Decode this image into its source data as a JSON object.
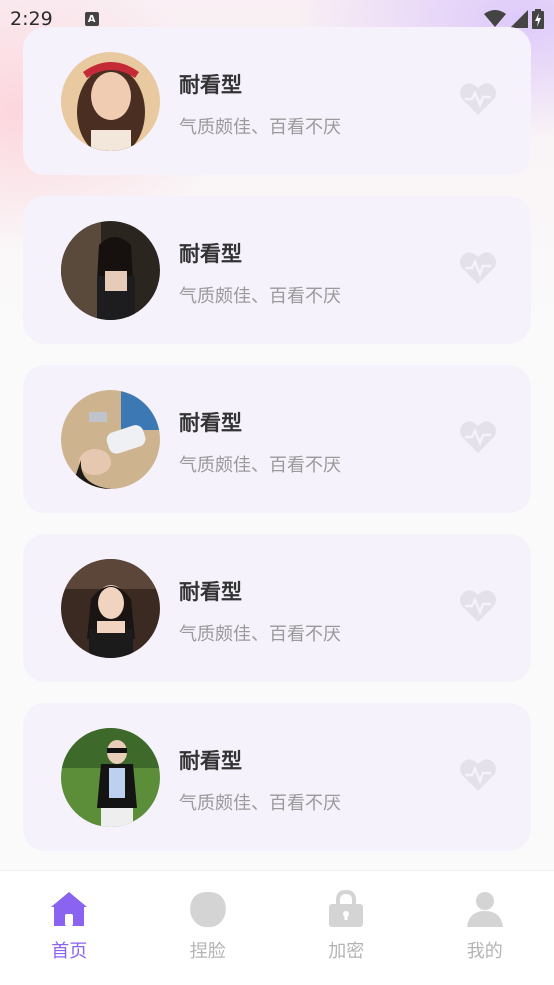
{
  "status": {
    "time": "2:29",
    "notif_letter": "A"
  },
  "cards": [
    {
      "title": "耐看型",
      "subtitle": "气质颇佳、百看不厌"
    },
    {
      "title": "耐看型",
      "subtitle": "气质颇佳、百看不厌"
    },
    {
      "title": "耐看型",
      "subtitle": "气质颇佳、百看不厌"
    },
    {
      "title": "耐看型",
      "subtitle": "气质颇佳、百看不厌"
    },
    {
      "title": "耐看型",
      "subtitle": "气质颇佳、百看不厌"
    }
  ],
  "tabs": [
    {
      "label": "首页",
      "icon": "home-icon",
      "active": true
    },
    {
      "label": "捏脸",
      "icon": "face-icon",
      "active": false
    },
    {
      "label": "加密",
      "icon": "lock-icon",
      "active": false
    },
    {
      "label": "我的",
      "icon": "user-icon",
      "active": false
    }
  ],
  "colors": {
    "accent": "#8a63f0",
    "inactive": "#d4d4d4",
    "card": "#f6f2fc"
  }
}
